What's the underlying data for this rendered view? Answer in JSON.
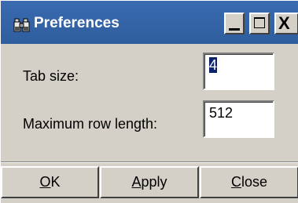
{
  "window": {
    "title": "Preferences",
    "title_icon": "binoculars-icon",
    "controls": {
      "minimize_icon": "minimize-icon",
      "maximize_icon": "maximize-icon",
      "close_icon": "close-icon",
      "close_glyph": "X"
    },
    "titlebar_color": "#3465a4",
    "background_color": "#d4d0c8"
  },
  "form": {
    "tab_size": {
      "label": "Tab size:",
      "value": "4"
    },
    "max_row_length": {
      "label": "Maximum row length:",
      "value": "512"
    }
  },
  "buttons": {
    "ok": {
      "mnemonic": "O",
      "rest": "K"
    },
    "apply": {
      "mnemonic": "A",
      "rest": "pply"
    },
    "close": {
      "mnemonic": "C",
      "rest": "lose"
    }
  },
  "selection_color": "#0a246a"
}
